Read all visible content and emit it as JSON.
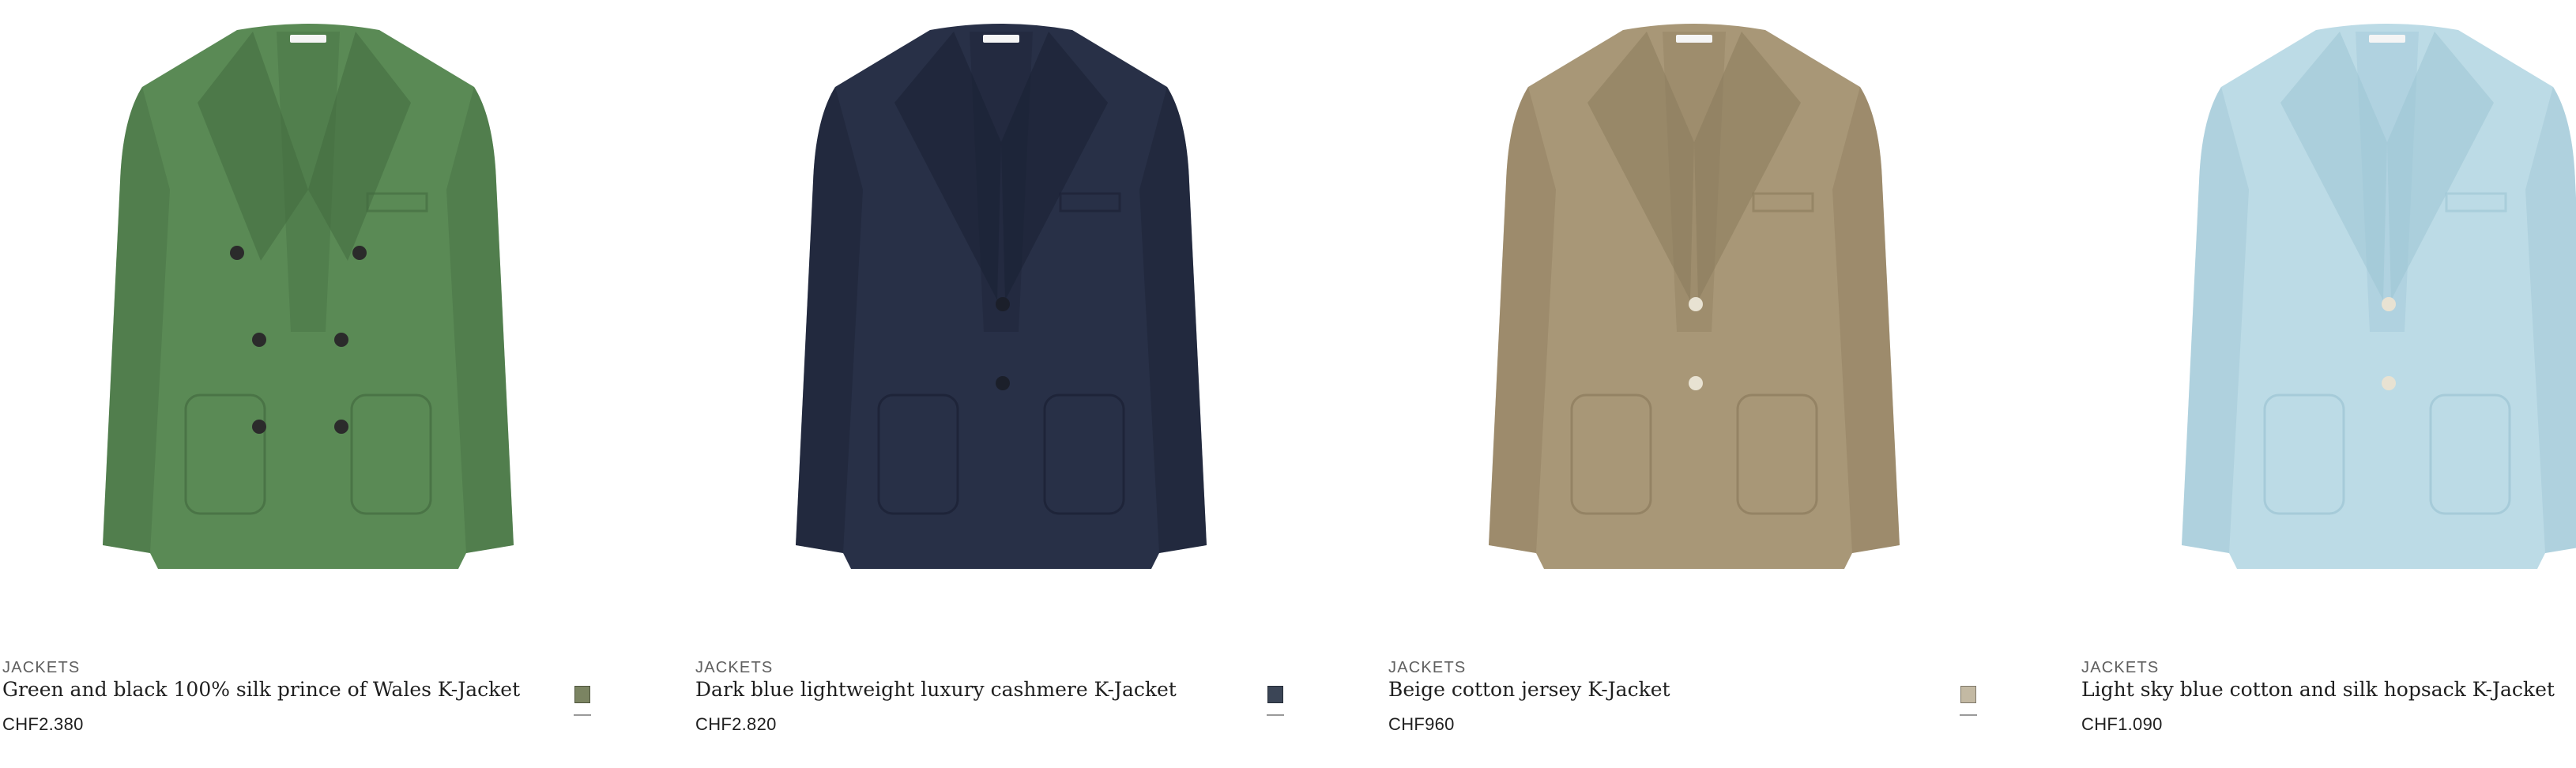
{
  "products": [
    {
      "category": "JACKETS",
      "title": "Green and black 100% silk prince of Wales K-Jacket",
      "price": "CHF2.380",
      "swatch_color": "#7b8462",
      "jacket_color": "#5a8a55",
      "jacket_shade": "#436b40",
      "jacket_style": "double-breasted",
      "image_alt": "green-double-breasted-jacket"
    },
    {
      "category": "JACKETS",
      "title": "Dark blue lightweight luxury cashmere K-Jacket",
      "price": "CHF2.820",
      "swatch_color": "#3b4556",
      "jacket_color": "#283047",
      "jacket_shade": "#1a2033",
      "jacket_style": "single-breasted",
      "image_alt": "navy-single-breasted-jacket"
    },
    {
      "category": "JACKETS",
      "title": "Beige cotton jersey K-Jacket",
      "price": "CHF960",
      "swatch_color": "#c3b9a3",
      "jacket_color": "#a89777",
      "jacket_shade": "#8b7b5c",
      "jacket_style": "single-breasted",
      "image_alt": "beige-single-breasted-jacket"
    },
    {
      "category": "JACKETS",
      "title": "Light sky blue cotton and silk hopsack K-Jacket",
      "price": "CHF1.090",
      "swatch_color": "#c2dde8",
      "jacket_color": "#bcdbe6",
      "jacket_shade": "#9cc4d3",
      "jacket_style": "single-breasted",
      "image_alt": "light-blue-single-breasted-jacket"
    }
  ]
}
